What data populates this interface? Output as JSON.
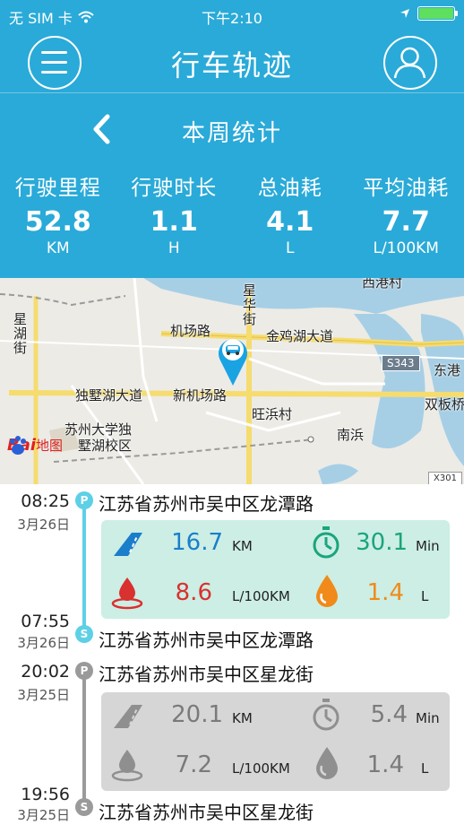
{
  "status_bar": {
    "carrier": "无 SIM 卡",
    "time": "下午2:10"
  },
  "nav": {
    "title": "行车轨迹"
  },
  "week": {
    "title": "本周统计"
  },
  "stats": [
    {
      "label": "行驶里程",
      "value": "52.8",
      "unit": "KM"
    },
    {
      "label": "行驶时长",
      "value": "1.1",
      "unit": "H"
    },
    {
      "label": "总油耗",
      "value": "4.1",
      "unit": "L"
    },
    {
      "label": "平均油耗",
      "value": "7.7",
      "unit": "L/100KM"
    }
  ],
  "map": {
    "labels": {
      "xigang": "西港村",
      "xinghua": "星华街",
      "xinghu": "星湖街",
      "airport": "机场路",
      "jinji": "金鸡湖大道",
      "s343": "S343",
      "donggang": "东港",
      "shuangban": "双板桥",
      "dushu": "独墅湖大道",
      "newairport": "新机场路",
      "wangbang": "旺浜村",
      "nanbang": "南浜",
      "university": "苏州大学独",
      "campus": "墅湖校区",
      "x301": "X301"
    },
    "logo": {
      "text": "Bai",
      "text2": "地图"
    }
  },
  "trips": [
    {
      "start": {
        "time": "08:25",
        "date": "3月26日",
        "address": "江苏省苏州市吴中区龙潭路",
        "badge": "P"
      },
      "end": {
        "time": "07:55",
        "date": "3月26日",
        "address": "江苏省苏州市吴中区龙潭路",
        "badge": "S"
      },
      "distance": "16.7",
      "distance_unit": "KM",
      "duration": "30.1",
      "duration_unit": "Min",
      "avg_fuel": "8.6",
      "avg_fuel_unit": "L/100KM",
      "fuel": "1.4",
      "fuel_unit": "L"
    },
    {
      "start": {
        "time": "20:02",
        "date": "3月25日",
        "address": "江苏省苏州市吴中区星龙街",
        "badge": "P"
      },
      "end": {
        "time": "19:56",
        "date": "3月25日",
        "address": "江苏省苏州市吴中区星龙街",
        "badge": "S"
      },
      "distance": "20.1",
      "distance_unit": "KM",
      "duration": "5.4",
      "duration_unit": "Min",
      "avg_fuel": "7.2",
      "avg_fuel_unit": "L/100KM",
      "fuel": "1.4",
      "fuel_unit": "L"
    }
  ],
  "colors": {
    "header": "#2aaad8",
    "active_line": "#5dd0e6",
    "inactive_line": "#9a9a9a",
    "distance": "#1a7ecb",
    "duration": "#1aa57c",
    "avg_fuel": "#d93030",
    "fuel": "#f08a1a"
  }
}
